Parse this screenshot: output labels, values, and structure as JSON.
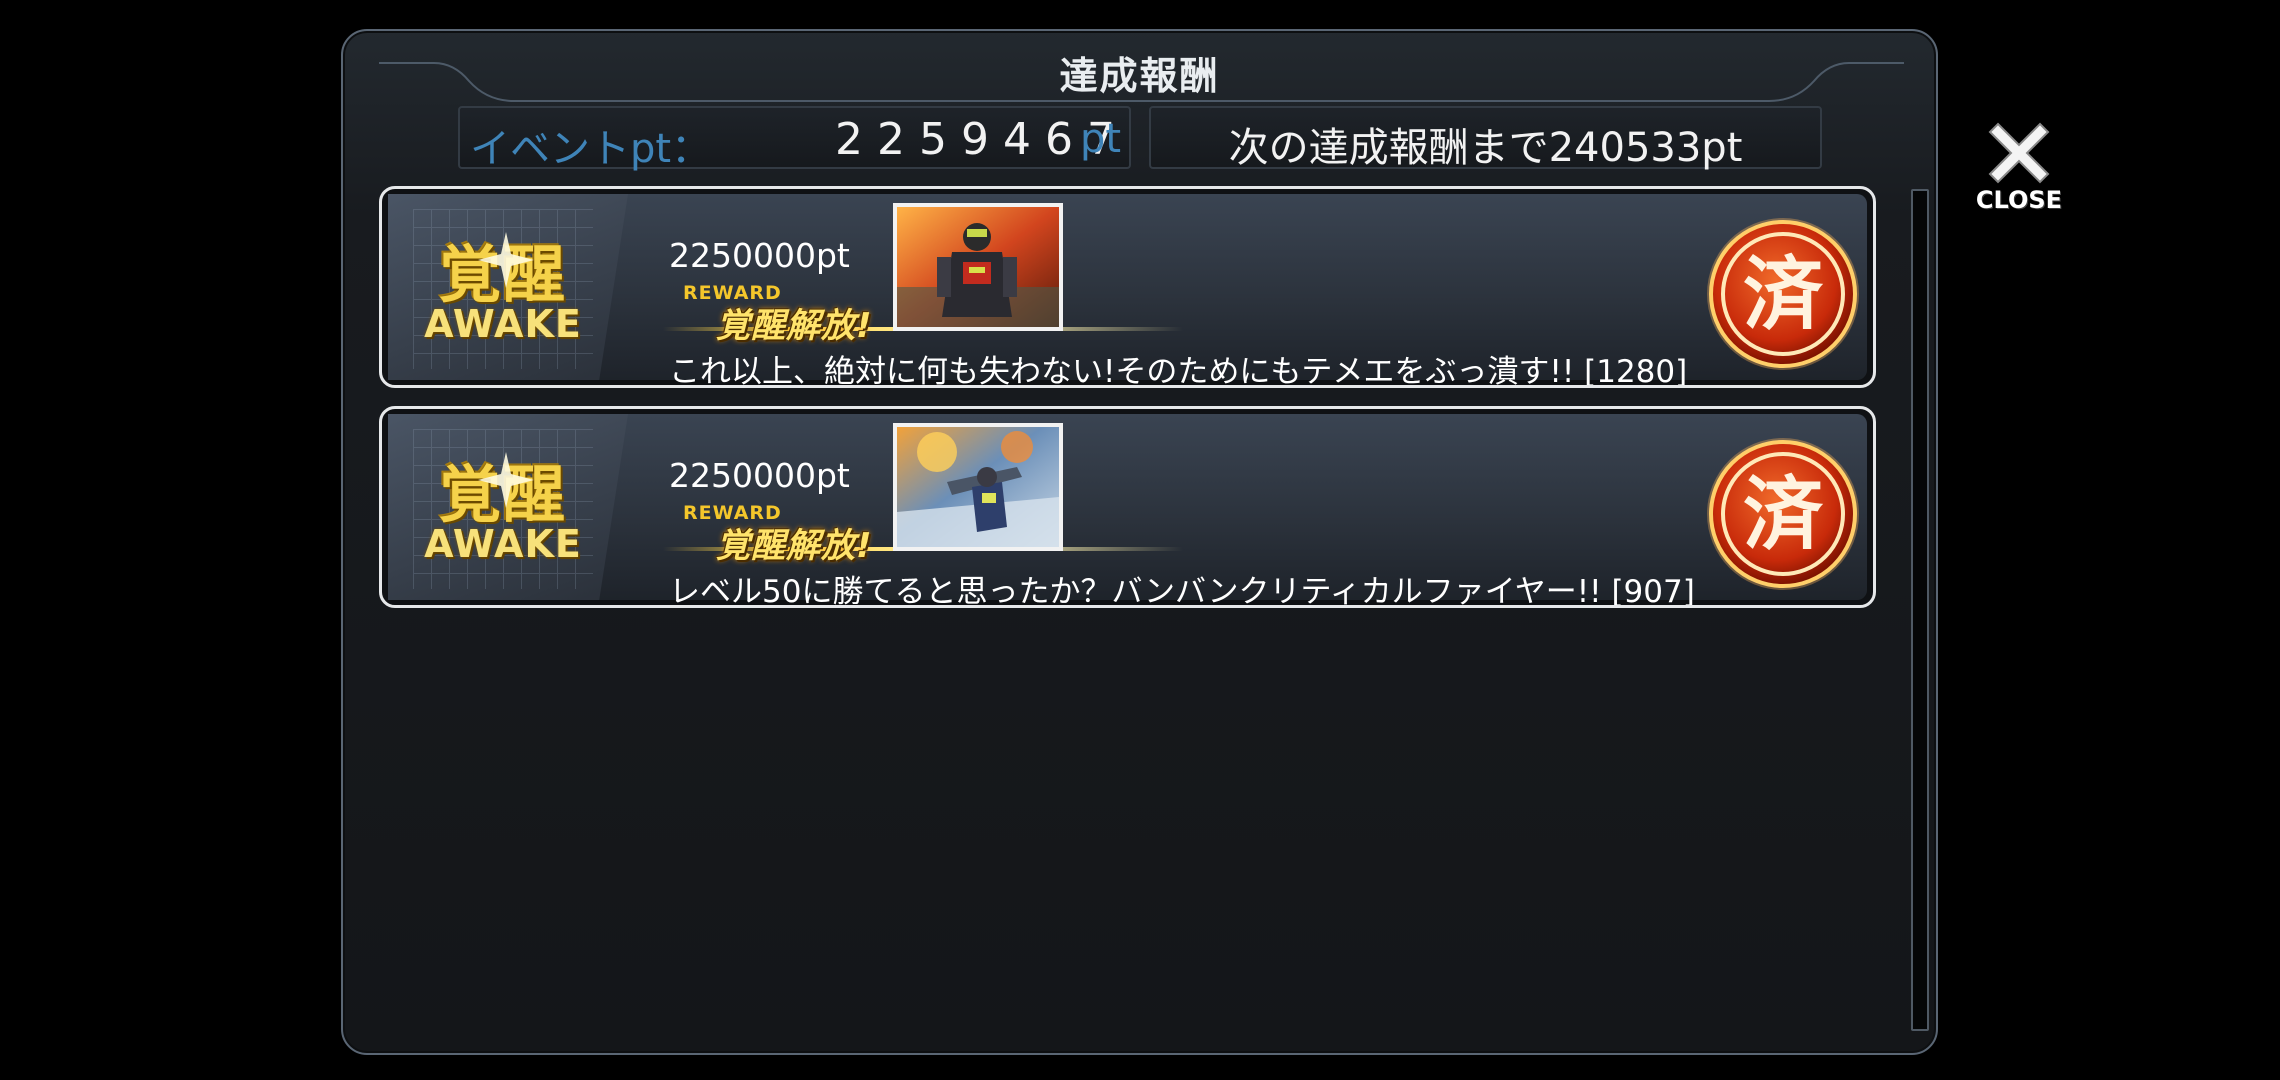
{
  "panel": {
    "title": "達成報酬"
  },
  "points": {
    "label": "イベントpt：",
    "value": "2259467",
    "unit": "pt",
    "next_text": "次の達成報酬まで240533pt"
  },
  "rewards": [
    {
      "badge_kanji": "覚醒",
      "badge_text": "AWAKE",
      "required_pt": "2250000pt",
      "reward_label": "REWARD",
      "unlock_text": "覚醒解放!",
      "description": "これ以上、絶対に何も失わない!そのためにもテメエをぶっ潰す!! [1280]",
      "stamp": "済"
    },
    {
      "badge_kanji": "覚醒",
      "badge_text": "AWAKE",
      "required_pt": "2250000pt",
      "reward_label": "REWARD",
      "unlock_text": "覚醒解放!",
      "description": "レベル50に勝てると思ったか？バンバンクリティカルファイヤー!! [907]",
      "stamp": "済"
    }
  ],
  "close": {
    "label": "CLOSE"
  },
  "colors": {
    "pt_label": "#3f84b8",
    "gold": "#f5d24a",
    "stamp_red": "#d8360a"
  }
}
